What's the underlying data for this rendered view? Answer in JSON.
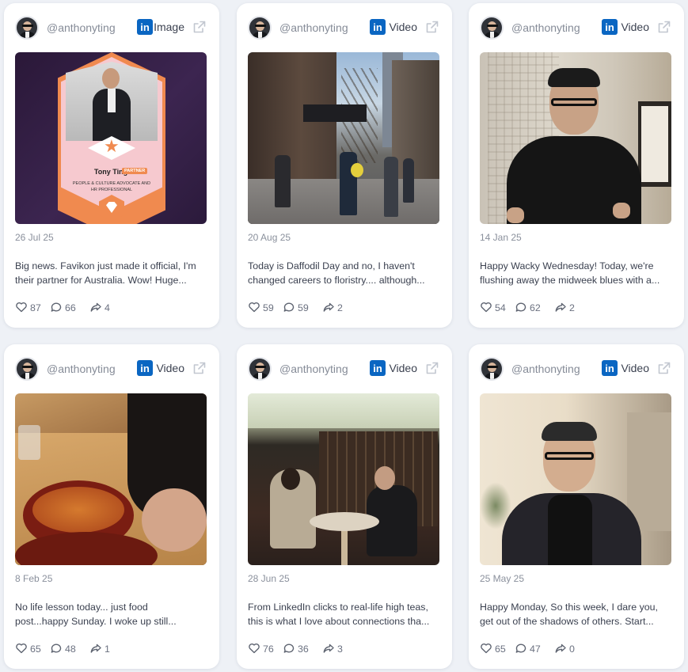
{
  "icons": {
    "like": "heart-icon",
    "comment": "comment-icon",
    "share": "share-arrow-icon",
    "platform": "linkedin-icon",
    "external": "external-link-icon"
  },
  "colors": {
    "linkedin": "#0a66c2",
    "background": "#eef1f6",
    "accent": "#f08a4f"
  },
  "posts": [
    {
      "author": "@anthonyting",
      "type": "Image",
      "date": "26 Jul 25",
      "text_lines": [
        "Big news. Favikon just made it official, I'm",
        "their partner for Australia. Wow! Huge..."
      ],
      "likes": "87",
      "comments": "66",
      "shares": "4",
      "media": {
        "name_text": "Tony Ting",
        "badge_text": "PARTNER",
        "role_text": "PEOPLE & CULTURE ADVOCATE AND HR PROFESSIONAL"
      }
    },
    {
      "author": "@anthonyting",
      "type": "Video",
      "date": "20 Aug 25",
      "text_lines": [
        "Today is Daffodil Day and no, I haven't",
        "changed careers to floristry.... although..."
      ],
      "likes": "59",
      "comments": "59",
      "shares": "2"
    },
    {
      "author": "@anthonyting",
      "type": "Video",
      "date": "14 Jan 25",
      "text_lines": [
        "Happy Wacky Wednesday! Today, we're",
        "flushing away the midweek blues with a..."
      ],
      "likes": "54",
      "comments": "62",
      "shares": "2"
    },
    {
      "author": "@anthonyting",
      "type": "Video",
      "date": "8 Feb 25",
      "text_lines": [
        "No life lesson today... just food",
        "post...happy Sunday. I woke up still..."
      ],
      "likes": "65",
      "comments": "48",
      "shares": "1"
    },
    {
      "author": "@anthonyting",
      "type": "Video",
      "date": "28 Jun 25",
      "text_lines": [
        "From LinkedIn clicks to real-life high teas,",
        "this is what I love about connections tha..."
      ],
      "likes": "76",
      "comments": "36",
      "shares": "3"
    },
    {
      "author": "@anthonyting",
      "type": "Video",
      "date": "25 May 25",
      "text_lines": [
        "Happy Monday, So this week, I dare you,",
        "get out of the shadows of others. Start..."
      ],
      "likes": "65",
      "comments": "47",
      "shares": "0"
    }
  ]
}
